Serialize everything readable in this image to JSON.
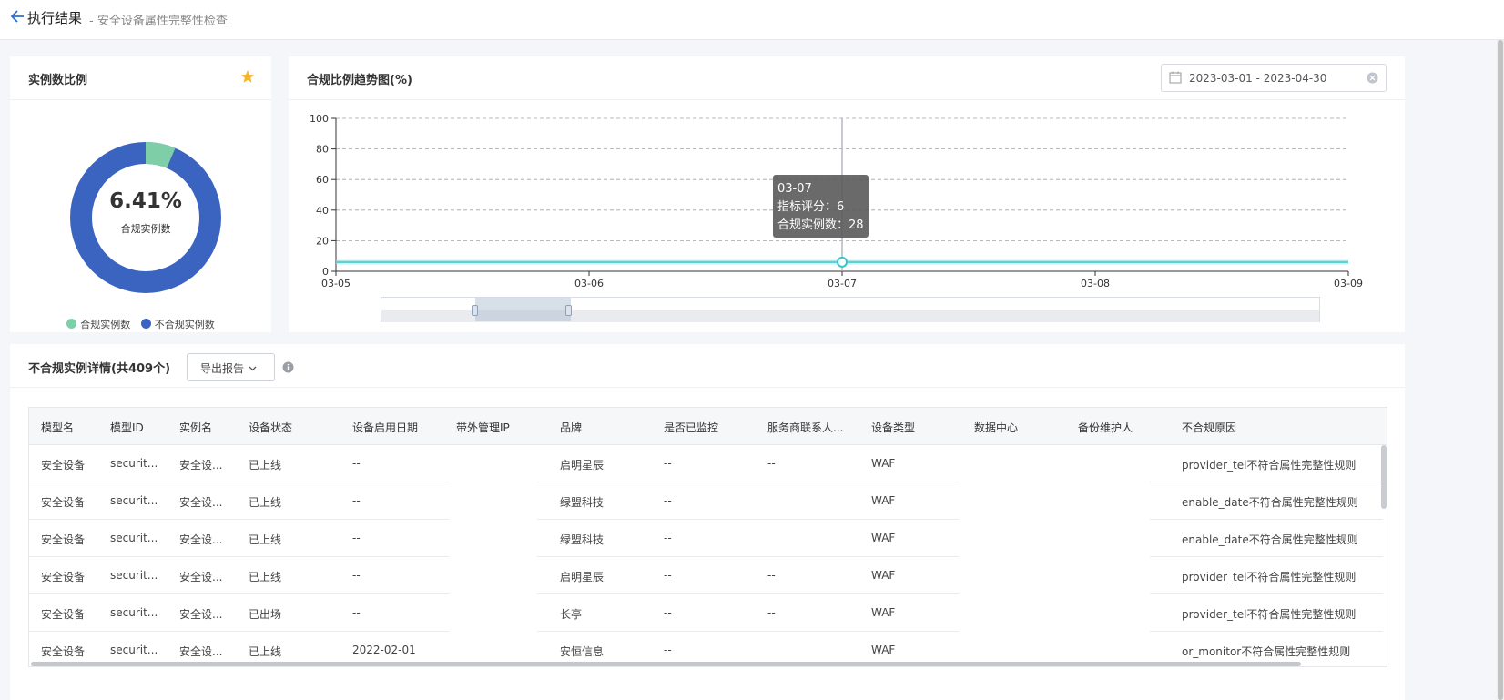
{
  "header": {
    "title": "执行结果",
    "subtitle": "- 安全设备属性完整性检查"
  },
  "ratio_card": {
    "title": "实例数比例",
    "percent": "6.41%",
    "center_label": "合规实例数",
    "legend": [
      {
        "label": "合规实例数",
        "color": "#7ecfa8"
      },
      {
        "label": "不合规实例数",
        "color": "#3b63c0"
      }
    ],
    "compliant_fraction": 0.0641
  },
  "trend_card": {
    "title": "合规比例趋势图(%)",
    "date_range": "2023-03-01 - 2023-04-30",
    "tooltip": {
      "date": "03-07",
      "score_label": "指标评分：",
      "score": "6",
      "count_label": "合规实例数：",
      "count": "28"
    },
    "line_color": "#37c5c9"
  },
  "chart_data": {
    "type": "line",
    "title": "合规比例趋势图(%)",
    "xlabel": "",
    "ylabel": "",
    "x": [
      "03-05",
      "03-06",
      "03-07",
      "03-08",
      "03-09"
    ],
    "x_ticks": [
      "03-05",
      "03-06",
      "03-07",
      "03-08",
      "03-09"
    ],
    "y_ticks": [
      "0",
      "20",
      "40",
      "60",
      "80",
      "100"
    ],
    "ylim": [
      0,
      100
    ],
    "grid": true,
    "series": [
      {
        "values": [
          6,
          6,
          6,
          6,
          6
        ]
      }
    ],
    "highlight": {
      "x": "03-07",
      "y": 6
    }
  },
  "detail": {
    "title": "不合规实例详情(共409个)",
    "export_label": "导出报告",
    "columns": [
      "模型名",
      "模型ID",
      "实例名",
      "设备状态",
      "设备启用日期",
      "带外管理IP",
      "品牌",
      "是否已监控",
      "服务商联系人...",
      "设备类型",
      "数据中心",
      "备份维护人",
      "不合规原因"
    ],
    "rows": [
      [
        "安全设备",
        "securit...",
        "安全设...",
        "已上线",
        "--",
        "",
        "启明星辰",
        "--",
        "--",
        "WAF",
        "",
        "",
        "provider_tel不符合属性完整性规则"
      ],
      [
        "安全设备",
        "securit...",
        "安全设...",
        "已上线",
        "--",
        "",
        "绿盟科技",
        "--",
        "",
        "WAF",
        "",
        "",
        "enable_date不符合属性完整性规则"
      ],
      [
        "安全设备",
        "securit...",
        "安全设...",
        "已上线",
        "--",
        "",
        "绿盟科技",
        "--",
        "",
        "WAF",
        "",
        "",
        "enable_date不符合属性完整性规则"
      ],
      [
        "安全设备",
        "securit...",
        "安全设...",
        "已上线",
        "--",
        "",
        "启明星辰",
        "--",
        "--",
        "WAF",
        "",
        "",
        "provider_tel不符合属性完整性规则"
      ],
      [
        "安全设备",
        "securit...",
        "安全设...",
        "已出场",
        "--",
        "",
        "长亭",
        "--",
        "--",
        "WAF",
        "",
        "",
        "provider_tel不符合属性完整性规则"
      ],
      [
        "安全设备",
        "securit...",
        "安全设...",
        "已上线",
        "2022-02-01",
        "",
        "安恒信息",
        "--",
        "",
        "WAF",
        "",
        "",
        "or_monitor不符合属性完整性规则"
      ]
    ]
  }
}
